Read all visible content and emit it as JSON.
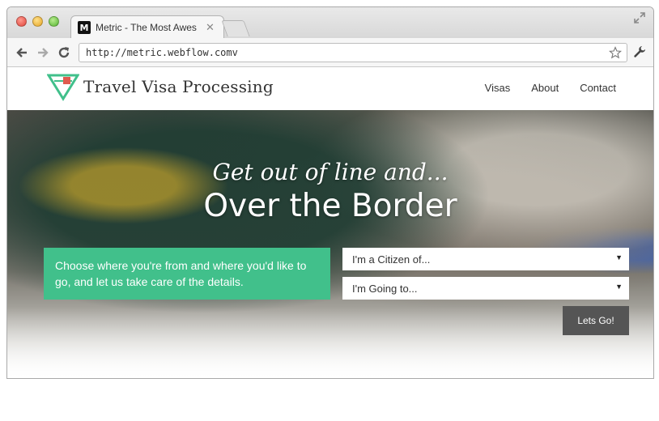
{
  "browser": {
    "tab_title": "Metric - The Most Awes",
    "tab_favicon": "M",
    "url": "http://metric.webflow.comv"
  },
  "icons": {
    "back": "back-arrow-icon",
    "forward": "forward-arrow-icon",
    "reload": "reload-icon",
    "bookmark": "star-icon",
    "menu": "wrench-icon",
    "fullscreen": "resize-icon"
  },
  "site": {
    "brand": "Travel Visa Processing",
    "nav": [
      "Visas",
      "About",
      "Contact"
    ]
  },
  "hero": {
    "tagline": "Get out of line and...",
    "title": "Over the Border",
    "intro": "Choose where you're from and where you'd like to go, and let us take care of the details.",
    "citizen_select": "I'm a Citizen of...",
    "destination_select": "I'm Going to...",
    "go_button": "Lets Go!"
  },
  "colors": {
    "accent_green": "#41c08b",
    "logo_red": "#e05a4e"
  }
}
